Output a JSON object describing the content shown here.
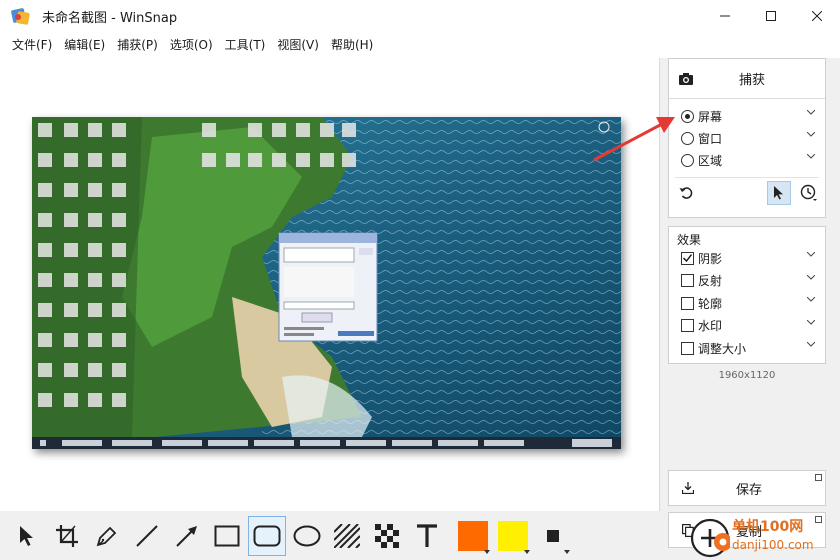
{
  "window": {
    "title": "未命名截图 - WinSnap"
  },
  "menu": [
    "文件(F)",
    "编辑(E)",
    "捕获(P)",
    "选项(O)",
    "工具(T)",
    "视图(V)",
    "帮助(H)"
  ],
  "capture": {
    "button_label": "捕获",
    "modes": [
      {
        "label": "屏幕",
        "selected": true
      },
      {
        "label": "窗口",
        "selected": false
      },
      {
        "label": "区域",
        "selected": false
      }
    ]
  },
  "effects": {
    "title": "效果",
    "items": [
      {
        "label": "阴影",
        "checked": true
      },
      {
        "label": "反射",
        "checked": false
      },
      {
        "label": "轮廓",
        "checked": false
      },
      {
        "label": "水印",
        "checked": false
      },
      {
        "label": "调整大小",
        "checked": false
      }
    ]
  },
  "image_size": "1960x1120",
  "actions": {
    "save_label": "保存",
    "copy_label": "复制"
  },
  "toolbar": {
    "tools": [
      "pointer-icon",
      "crop-icon",
      "pen-icon",
      "line-icon",
      "arrow-icon",
      "rectangle-icon",
      "rounded-rectangle-icon",
      "ellipse-icon",
      "hatch-icon",
      "checker-icon",
      "text-icon"
    ],
    "selected_tool": "rounded-rectangle-icon",
    "color_primary": "#ff6a00",
    "color_secondary": "#ffef00",
    "color_outline": "#222222"
  },
  "colors": {
    "accent_arrow": "#e53935",
    "sea": "#1f6f8f",
    "cliff": "#3d7a30"
  },
  "watermark": {
    "line1": "单机100网",
    "line2": "danji100.com"
  }
}
